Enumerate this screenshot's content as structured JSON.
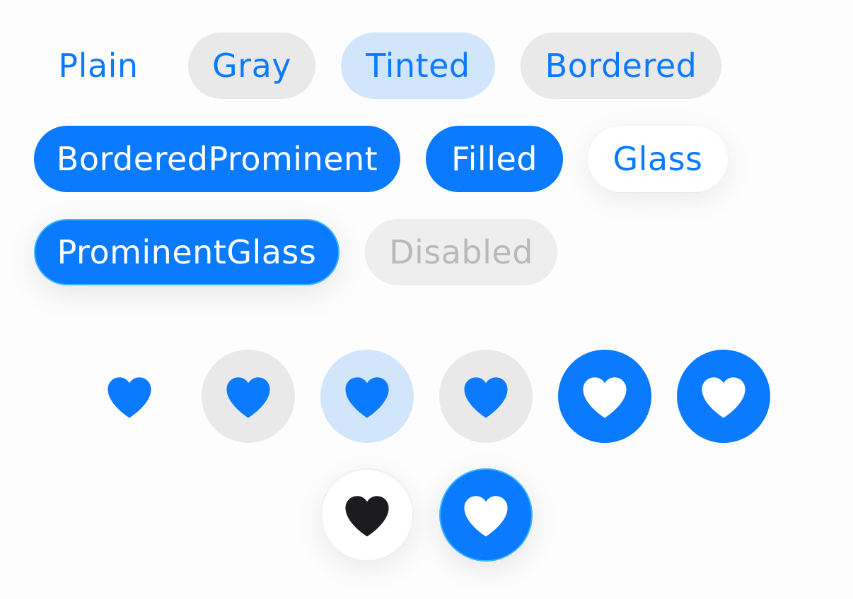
{
  "colors": {
    "accent": "#0a7aff",
    "gray_fill": "#e9e9ea",
    "tinted_fill": "#d2e6fb",
    "disabled_text": "#b9b9bb",
    "glass_icon": "#1c1c1e"
  },
  "text_buttons": {
    "plain": "Plain",
    "gray": "Gray",
    "tinted": "Tinted",
    "bordered": "Bordered",
    "bordered_prominent": "BorderedProminent",
    "filled": "Filled",
    "glass": "Glass",
    "prominent_glass": "ProminentGlass",
    "disabled": "Disabled"
  },
  "icon_buttons": {
    "icon": "heart-icon",
    "styles": [
      "plain",
      "gray",
      "tinted",
      "bordered",
      "bordered-prominent",
      "filled",
      "glass",
      "prominent-glass"
    ]
  }
}
